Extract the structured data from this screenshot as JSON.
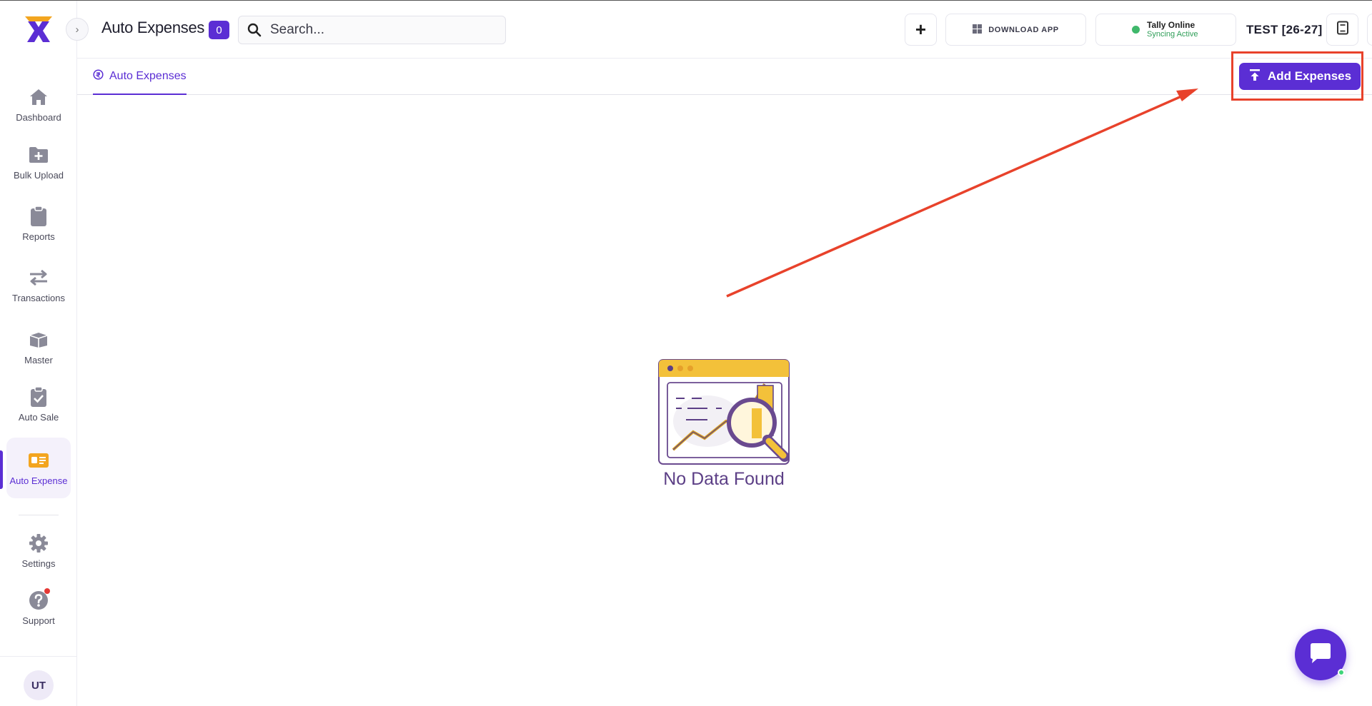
{
  "header": {
    "title": "Auto Expenses",
    "count": "0",
    "search_placeholder": "Search...",
    "download_label": "DOWNLOAD APP",
    "tally_title": "Tally Online",
    "tally_status": "Syncing Active",
    "company": "TEST [26-27]",
    "avatar": "UT"
  },
  "sidebar": {
    "items": [
      {
        "label": "Dashboard",
        "icon": "home-icon"
      },
      {
        "label": "Bulk Upload",
        "icon": "folder-plus-icon"
      },
      {
        "label": "Reports",
        "icon": "clipboard-icon"
      },
      {
        "label": "Transactions",
        "icon": "swap-arrows-icon"
      },
      {
        "label": "Master",
        "icon": "box-icon"
      },
      {
        "label": "Auto Sale",
        "icon": "clipboard-check-icon"
      },
      {
        "label": "Auto Expense",
        "icon": "id-card-icon",
        "active": true
      },
      {
        "label": "Settings",
        "icon": "gear-icon"
      },
      {
        "label": "Support",
        "icon": "help-icon"
      }
    ],
    "avatar": "UT"
  },
  "tabs": [
    {
      "label": "Auto Expenses",
      "active": true
    }
  ],
  "actions": {
    "add_label": "Add Expenses"
  },
  "empty_state": {
    "message": "No Data Found"
  },
  "colors": {
    "accent": "#5b2ed4",
    "annotation": "#e8422b",
    "online": "#3fb86b",
    "illustration_yellow": "#f3c13a"
  }
}
